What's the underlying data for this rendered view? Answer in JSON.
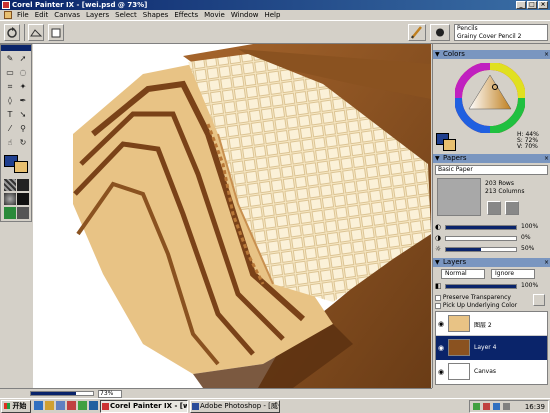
{
  "window": {
    "title": "Corel Painter IX - [wei.psd @ 73%]",
    "controls": [
      "_",
      "□",
      "×"
    ]
  },
  "menu": [
    "File",
    "Edit",
    "Canvas",
    "Layers",
    "Select",
    "Shapes",
    "Effects",
    "Movie",
    "Window",
    "Help"
  ],
  "propbar": {
    "brush_category": "Pencils",
    "brush_variant": "Grainy Cover Pencil 2"
  },
  "colors": {
    "title": "Colors",
    "h_value": "H: 44%",
    "s_value": "S: 72%",
    "v_value": "V: 70%",
    "main_color": "#1f3f8f",
    "secondary_color": "#e8c070"
  },
  "papers": {
    "title": "Papers",
    "paper_name": "Basic Paper",
    "rows": "203 Rows",
    "columns": "213 Columns",
    "sliders": [
      {
        "value": "100%"
      },
      {
        "value": "0%"
      },
      {
        "value": "50%"
      }
    ]
  },
  "layers": {
    "title": "Layers",
    "composite_method": "Normal",
    "composite_depth": "Ignore",
    "opacity": "100%",
    "preserve_transparency": "Preserve Transparency",
    "pick_up_underlying": "Pick Up Underlying Color",
    "items": [
      {
        "name": "图层 2",
        "selected": false
      },
      {
        "name": "Layer 4",
        "selected": true
      },
      {
        "name": "Canvas",
        "selected": false
      }
    ]
  },
  "status": {
    "zoom": "73%"
  },
  "taskbar": {
    "start_label": "开始",
    "tasks": [
      {
        "label": "Corel Painter IX - [wei...",
        "active": true
      },
      {
        "label": "Adobe Photoshop - [威化...",
        "active": false
      }
    ],
    "clock": "16:39"
  },
  "accent_colors": {
    "title_bar": "#0a246a",
    "panel_header": "#7a96c0",
    "selected_layer": "#0a246a",
    "wafer_cream": "#f4e2b8",
    "chocolate": "#7a4a20"
  }
}
